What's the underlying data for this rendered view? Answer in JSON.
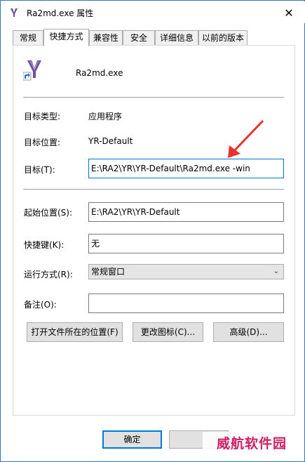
{
  "window": {
    "title": "Ra2md.exe 属性",
    "close_glyph": "✕"
  },
  "tabs": [
    {
      "label": "常规"
    },
    {
      "label": "快捷方式"
    },
    {
      "label": "兼容性"
    },
    {
      "label": "安全"
    },
    {
      "label": "详细信息"
    },
    {
      "label": "以前的版本"
    }
  ],
  "shortcut": {
    "file_name": "Ra2md.exe",
    "target_type_label": "目标类型:",
    "target_type_value": "应用程序",
    "target_location_label": "目标位置:",
    "target_location_value": "YR-Default",
    "target_label": "目标(T):",
    "target_value": "E:\\RA2\\YR\\YR-Default\\Ra2md.exe -win",
    "start_in_label": "起始位置(S):",
    "start_in_value": "E:\\RA2\\YR\\YR-Default",
    "shortcut_key_label": "快捷键(K):",
    "shortcut_key_value": "无",
    "run_label": "运行方式(R):",
    "run_value": "常规窗口",
    "comment_label": "备注(O):",
    "comment_value": ""
  },
  "buttons": {
    "open_location": "打开文件所在的位置(F)",
    "change_icon": "更改图标(C)...",
    "advanced": "高级(D)...",
    "ok": "确定"
  },
  "watermark": "威航软件园",
  "colors": {
    "accent": "#0078d7",
    "annotation_arrow": "#e8322e",
    "watermark": "#d01f67"
  }
}
